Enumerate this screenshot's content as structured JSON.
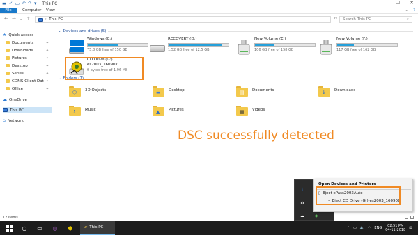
{
  "window": {
    "title": "This PC",
    "min": "—",
    "max": "☐",
    "close": "✕"
  },
  "ribbon": {
    "tabs": [
      "File",
      "Computer",
      "View"
    ]
  },
  "address": {
    "path": "This PC",
    "search_placeholder": "Search This PC"
  },
  "sidebar": {
    "items": [
      {
        "label": "Quick access",
        "icon": "star-icon"
      },
      {
        "label": "Documents",
        "icon": "folder-icon",
        "pinned": true
      },
      {
        "label": "Downloads",
        "icon": "folder-icon",
        "pinned": true
      },
      {
        "label": "Pictures",
        "icon": "folder-icon",
        "pinned": true
      },
      {
        "label": "Desktop",
        "icon": "folder-icon",
        "pinned": true
      },
      {
        "label": "Series",
        "icon": "folder-icon",
        "pinned": true
      },
      {
        "label": "CDMS-Client Dat",
        "icon": "folder-icon",
        "pinned": true
      },
      {
        "label": "Office",
        "icon": "folder-icon",
        "pinned": true
      },
      {
        "label": "OneDrive",
        "icon": "cloud-icon"
      },
      {
        "label": "This PC",
        "icon": "pc-icon",
        "selected": true
      },
      {
        "label": "Network",
        "icon": "network-icon"
      }
    ]
  },
  "devices": {
    "header": "Devices and drives (5)",
    "drives": [
      {
        "name": "Windows (C:)",
        "free": "75.8 GB free of 150 GB",
        "used_fraction": 0.5
      },
      {
        "name": "RECOVERY (D:)",
        "free": "1.52 GB free of 12.5 GB",
        "used_fraction": 0.88
      },
      {
        "name": "New Volume (E:)",
        "free": "106 GB free of 158 GB",
        "used_fraction": 0.33
      },
      {
        "name": "New Volume (F:)",
        "free": "117 GB free of 162 GB",
        "used_fraction": 0.28
      },
      {
        "name": "CD Drive (G:)",
        "label2": "es2003_160907",
        "free": "0 bytes free of 1.96 MB",
        "used_fraction": 1.0
      }
    ]
  },
  "folders": {
    "header": "Folders (7)",
    "items": [
      "3D Objects",
      "Desktop",
      "Documents",
      "Downloads",
      "Music",
      "Pictures",
      "Videos"
    ]
  },
  "annotation": {
    "text": "DSC successfully detected",
    "color": "#f08a24"
  },
  "status": {
    "items": "12 items"
  },
  "taskbar": {
    "explorer_label": "This PC",
    "lang": "ENG",
    "time": "02:51 PM",
    "date": "04-11-2018"
  },
  "context_menu": {
    "header": "Open Devices and Printers",
    "eject_token": "Eject ePass2003Auto",
    "eject_cd": "Eject CD Drive (G:) es2003_160907"
  },
  "colors": {
    "accent": "#1979ca",
    "highlight": "#f08a24",
    "usage_bar": "#26a0da"
  }
}
